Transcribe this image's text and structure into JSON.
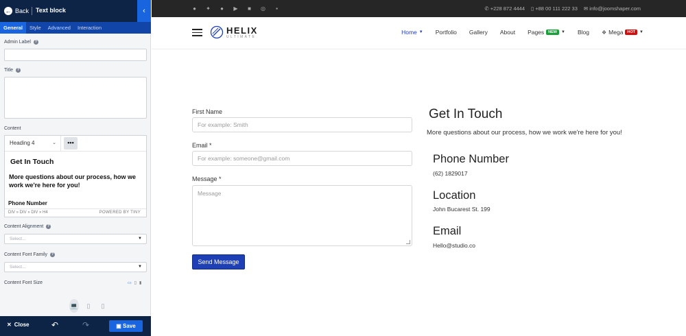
{
  "editor": {
    "back_label": "Back",
    "panel_title": "Text block",
    "tabs": [
      "General",
      "Style",
      "Advanced",
      "Interaction"
    ],
    "admin_label": "Admin Label",
    "title_label": "Title",
    "content_label": "Content",
    "format_value": "Heading 4",
    "more_label": "•••",
    "content_heading": "Get In Touch",
    "content_paragraph": "More questions about our process, how we work we're here for you!",
    "content_phone": "Phone Number",
    "status_path": "DIV » DIV » DIV » H4",
    "powered_by": "POWERED BY TINY",
    "alignment_label": "Content Alignment",
    "alignment_placeholder": "Select...",
    "font_family_label": "Content Font Family",
    "font_family_placeholder": "Select...",
    "font_size_label": "Content Font Size",
    "close_label": "Close",
    "save_label": "Save"
  },
  "site": {
    "contacts": [
      "+228 872 4444",
      "+88 00 111 222 33",
      "info@joomshaper.com"
    ],
    "socials": [
      "facebook-icon",
      "twitter-icon",
      "pinterest-icon",
      "youtube-icon",
      "linkedin-icon",
      "instagram-icon",
      "flickr-icon"
    ],
    "logo_main": "HELIX",
    "logo_sub": "ULTIMATE",
    "nav": {
      "home": "Home",
      "portfolio": "Portfolio",
      "gallery": "Gallery",
      "about": "About",
      "pages": "Pages",
      "pages_badge": "NEW",
      "blog": "Blog",
      "mega": "Mega",
      "mega_badge": "HOT"
    },
    "form": {
      "first_name_label": "First Name",
      "first_name_placeholder": "For example: Smith",
      "email_label": "Email *",
      "email_placeholder": "For example: someone@gmail.com",
      "message_label": "Message *",
      "message_placeholder": "Message",
      "send_label": "Send Message"
    },
    "contact": {
      "title": "Get In Touch",
      "subtitle": "More questions about our process, how we work we're here for you!",
      "phone_heading": "Phone Number",
      "phone_value": "(62) 1829017",
      "location_heading": "Location",
      "location_value": "John Bucarest St. 199",
      "email_heading": "Email",
      "email_value": "Hello@studio.co"
    }
  },
  "colors": {
    "panel_dark": "#0d2447",
    "panel_accent": "#1965e0",
    "nav_active": "#1f3fb5",
    "badge_new": "#1d9e3a",
    "badge_hot": "#d10f0f"
  }
}
